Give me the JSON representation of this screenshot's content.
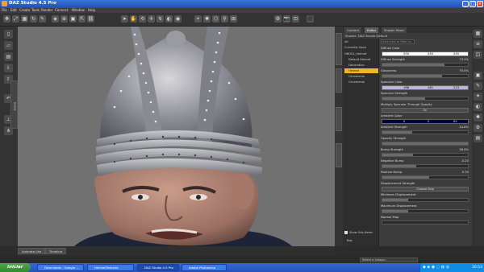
{
  "window": {
    "title": "DAZ Studio 4.5 Pro"
  },
  "menu": [
    "File",
    "Edit",
    "Create",
    "Tools",
    "Render",
    "Connect",
    "Window",
    "Help"
  ],
  "viewport": {
    "tabs": [
      "Animate Lite",
      "Timeline"
    ]
  },
  "dock": {
    "tabs": [
      "Content",
      "Editor",
      "Shader Mixer"
    ],
    "active_tab": "Editor",
    "shader_header": "Shader: DAZ Studio Default",
    "search_placeholder": "Enter text to filter by...",
    "tree": [
      "All",
      "Currently Used",
      "HBO01_Helmet",
      "Default Helmet",
      "Decoration",
      "Helmet",
      "Ornaments",
      "Ornaments"
    ],
    "selected_tree": "Helmet",
    "show_sub_items": "Show Sub-Items",
    "bottom_label": "Box"
  },
  "properties": {
    "diffuse_color": {
      "label": "Diffuse Color",
      "r": "255",
      "g": "255",
      "b": "255"
    },
    "diffuse_strength": {
      "label": "Diffuse Strength",
      "value": "73.2%"
    },
    "glossiness": {
      "label": "Glossiness",
      "value": "70.0%"
    },
    "specular_color": {
      "label": "Specular Color",
      "r": "188",
      "g": "181",
      "b": "213"
    },
    "specular_strength": {
      "label": "Specular Strength",
      "value": ""
    },
    "multiply_specular": {
      "label": "Multiply Specular Through Opacity",
      "value": "On"
    },
    "ambient_color": {
      "label": "Ambient Color",
      "r": "0",
      "g": "0",
      "b": "64"
    },
    "ambient_strength": {
      "label": "Ambient Strength",
      "value": "34.6%"
    },
    "opacity_strength": {
      "label": "Opacity Strength",
      "value": ""
    },
    "bump_strength": {
      "label": "Bump Strength",
      "value": "36.0%"
    },
    "negative_bump": {
      "label": "Negative Bump",
      "value": "-0.20"
    },
    "positive_bump": {
      "label": "Positive Bump",
      "value": "0.35"
    },
    "displacement_strength": {
      "label": "Displacement Strength",
      "value": "Choose Map"
    },
    "minimum_displacement": {
      "label": "Minimum Displacement",
      "value": ""
    },
    "maximum_displacement": {
      "label": "Maximum Displacement",
      "value": ""
    },
    "normal_map": {
      "label": "Normal Map",
      "value": ""
    }
  },
  "status": {
    "lesson_placeholder": "Select a Lesson..."
  },
  "taskbar": {
    "start": "Iniciar",
    "tasks": [
      "Downloads - Google ...",
      "HelmetTextures",
      "DAZ Studio 4.5 Pro",
      "Adobe Photoshop"
    ],
    "active_task": "DAZ Studio 4.5 Pro",
    "clock": "16:53"
  },
  "colors": {
    "accent_selected": "#f0b62a",
    "taskbar": "#2452b8",
    "start": "#2f8a2c"
  }
}
